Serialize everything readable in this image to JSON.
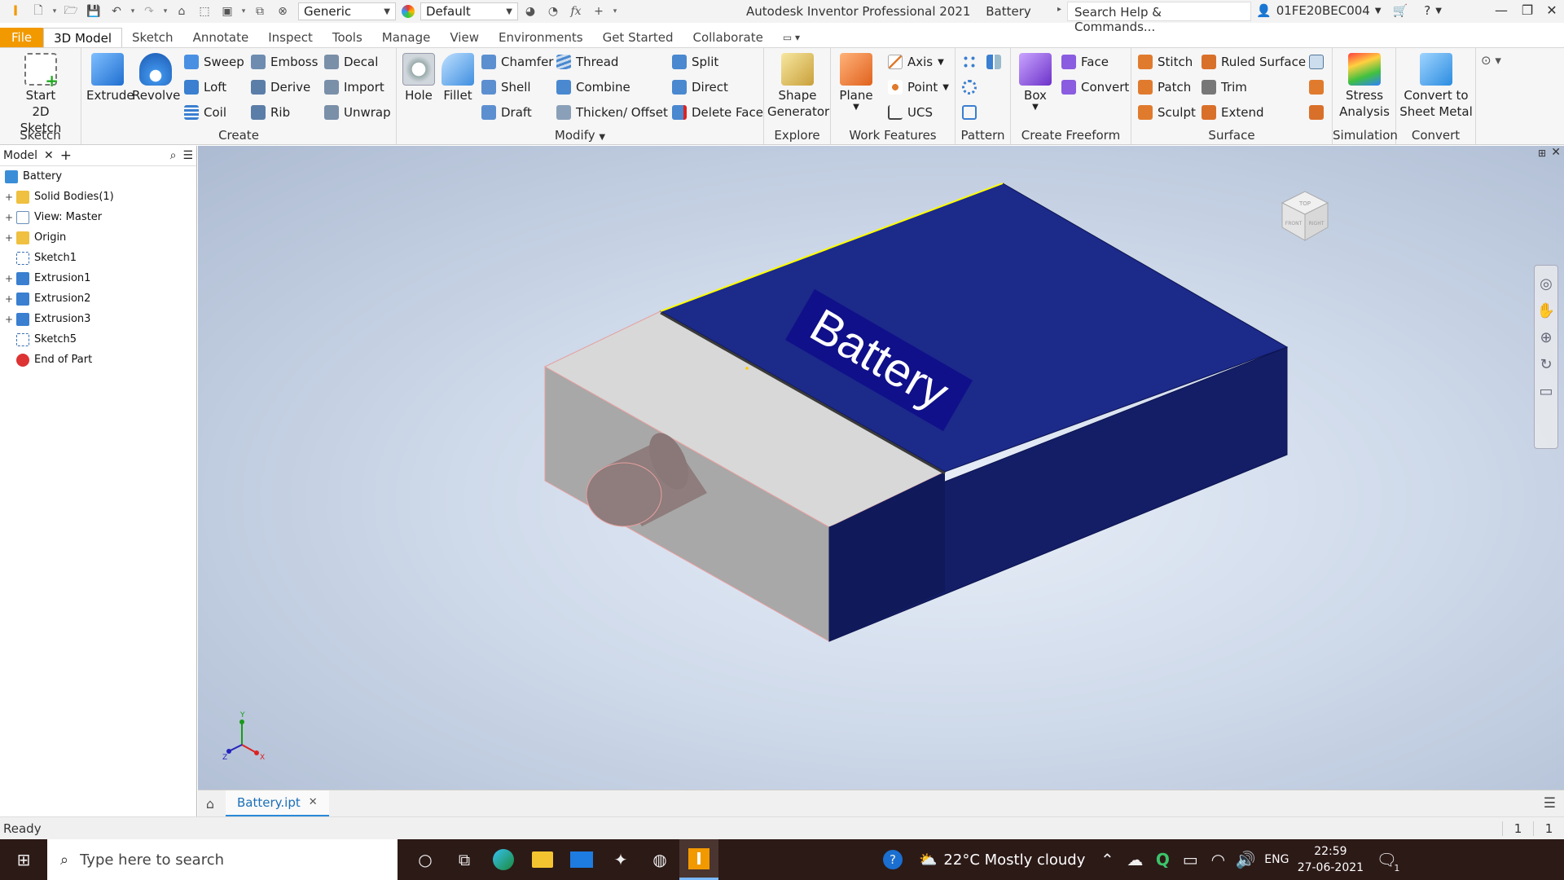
{
  "titlebar": {
    "style_combo": "Generic",
    "appearance_combo": "Default",
    "app_title": "Autodesk Inventor Professional 2021",
    "doc_title": "Battery",
    "search_placeholder": "Search Help & Commands...",
    "user": "01FE20BEC004"
  },
  "tabs": [
    "File",
    "3D Model",
    "Sketch",
    "Annotate",
    "Inspect",
    "Tools",
    "Manage",
    "View",
    "Environments",
    "Get Started",
    "Collaborate"
  ],
  "active_tab": "3D Model",
  "ribbon": {
    "sketch": {
      "label": "Sketch",
      "start_sketch_l1": "Start",
      "start_sketch_l2": "2D Sketch"
    },
    "create": {
      "label": "Create",
      "extrude": "Extrude",
      "revolve": "Revolve",
      "sweep": "Sweep",
      "loft": "Loft",
      "coil": "Coil",
      "emboss": "Emboss",
      "derive": "Derive",
      "rib": "Rib",
      "decal": "Decal",
      "import": "Import",
      "unwrap": "Unwrap"
    },
    "modify": {
      "label": "Modify",
      "hole": "Hole",
      "fillet": "Fillet",
      "chamfer": "Chamfer",
      "shell": "Shell",
      "draft": "Draft",
      "thread": "Thread",
      "combine": "Combine",
      "thicken": "Thicken/ Offset",
      "split": "Split",
      "direct": "Direct",
      "delete_face": "Delete Face"
    },
    "explore": {
      "label": "Explore",
      "shape_gen_l1": "Shape",
      "shape_gen_l2": "Generator"
    },
    "work": {
      "label": "Work Features",
      "plane": "Plane",
      "axis": "Axis",
      "point": "Point",
      "ucs": "UCS"
    },
    "pattern": {
      "label": "Pattern"
    },
    "freeform": {
      "label": "Create Freeform",
      "box": "Box",
      "face": "Face",
      "convert": "Convert"
    },
    "surface": {
      "label": "Surface",
      "stitch": "Stitch",
      "patch": "Patch",
      "sculpt": "Sculpt",
      "ruled": "Ruled Surface",
      "trim": "Trim",
      "extend": "Extend"
    },
    "simulation": {
      "label": "Simulation",
      "stress_l1": "Stress",
      "stress_l2": "Analysis"
    },
    "convert": {
      "label": "Convert",
      "sheet_l1": "Convert to",
      "sheet_l2": "Sheet Metal"
    }
  },
  "browser": {
    "tab": "Model",
    "items": [
      {
        "label": "Battery",
        "expand": "",
        "icon": "part",
        "indent": 0
      },
      {
        "label": "Solid Bodies(1)",
        "expand": "+",
        "icon": "folder",
        "indent": 1
      },
      {
        "label": "View: Master",
        "expand": "+",
        "icon": "view",
        "indent": 1
      },
      {
        "label": "Origin",
        "expand": "+",
        "icon": "folder",
        "indent": 1
      },
      {
        "label": "Sketch1",
        "expand": "",
        "icon": "sketch",
        "indent": 1
      },
      {
        "label": "Extrusion1",
        "expand": "+",
        "icon": "extrude",
        "indent": 1
      },
      {
        "label": "Extrusion2",
        "expand": "+",
        "icon": "extrude",
        "indent": 1
      },
      {
        "label": "Extrusion3",
        "expand": "+",
        "icon": "extrude",
        "indent": 1
      },
      {
        "label": "Sketch5",
        "expand": "",
        "icon": "sketch",
        "indent": 1
      },
      {
        "label": "End of Part",
        "expand": "",
        "icon": "end",
        "indent": 1
      }
    ]
  },
  "viewport": {
    "decal_text": "Battery",
    "viewcube_top": "TOP",
    "viewcube_front": "FRONT",
    "viewcube_right": "RIGHT",
    "triad_x": "X",
    "triad_y": "Y",
    "triad_z": "Z",
    "colors": {
      "body_top": "#1c2a8a",
      "body_side": "#141e66",
      "grey_top": "#d9d9d9",
      "grey_side": "#a9a9a9",
      "cylinder": "#8f7c7c",
      "decal_bg": "#10108a"
    }
  },
  "doctab": {
    "name": "Battery.ipt"
  },
  "status": {
    "text": "Ready",
    "n1": "1",
    "n2": "1"
  },
  "taskbar": {
    "search_placeholder": "Type here to search",
    "weather": "22°C  Mostly cloudy",
    "lang": "ENG",
    "time": "22:59",
    "date": "27-06-2021",
    "notif_count": "1"
  }
}
